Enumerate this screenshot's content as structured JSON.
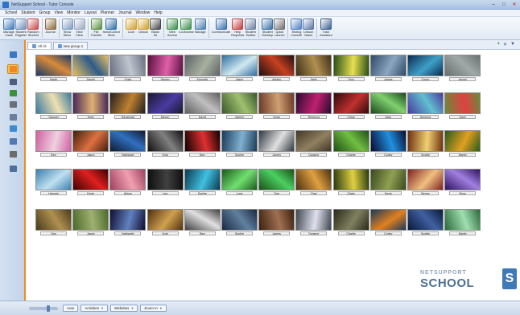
{
  "window": {
    "title": "NetSupport School - Tutor Console"
  },
  "menu": [
    "School",
    "Student",
    "Group",
    "View",
    "Monitor",
    "Layout",
    "Planner",
    "Journal",
    "Window",
    "Help"
  ],
  "toolbar": [
    {
      "id": "manage-class",
      "label": "Manage\nClass",
      "color": "#3f7ab8"
    },
    {
      "id": "student-register",
      "label": "Student\nRegister",
      "color": "#6f8fb8"
    },
    {
      "id": "random-student",
      "label": "Random\nStudent",
      "color": "#c94b4b"
    },
    {
      "sep": true
    },
    {
      "id": "journal",
      "label": "Journal",
      "color": "#8a6a3c"
    },
    {
      "sep": true
    },
    {
      "id": "show-menu",
      "label": "Show\nMenu",
      "color": "#7d9cc2"
    },
    {
      "id": "view-clear",
      "label": "View\nClear",
      "color": "#9aa9bd"
    },
    {
      "sep": true
    },
    {
      "id": "file-transfer",
      "label": "File\nTransfer",
      "color": "#5a8f3c"
    },
    {
      "id": "send-collect-work",
      "label": "Send/Collect\nWork",
      "color": "#2e6fa8"
    },
    {
      "sep": true
    },
    {
      "id": "lock",
      "label": "Lock",
      "color": "#d1a12a"
    },
    {
      "id": "unlock",
      "label": "Unlock",
      "color": "#d1a12a"
    },
    {
      "id": "blank-all",
      "label": "Blank\nAll",
      "color": "#474747"
    },
    {
      "sep": true
    },
    {
      "id": "web-access",
      "label": "Web\nAccess",
      "color": "#3c8f4a"
    },
    {
      "id": "co-browse",
      "label": "Co-Browse",
      "color": "#3c8f4a"
    },
    {
      "id": "manage",
      "label": "Manage",
      "color": "#4a7ab0"
    },
    {
      "sep": true
    },
    {
      "id": "communicate",
      "label": "Communicate",
      "color": "#3b6fb0"
    },
    {
      "id": "help-requests",
      "label": "Help\nRequests",
      "color": "#c03c3c"
    },
    {
      "id": "student-toolbar",
      "label": "Student\nToolbar",
      "color": "#6a7fa0"
    },
    {
      "sep": true
    },
    {
      "id": "student-desktop",
      "label": "Student\nDesktop",
      "color": "#3a6da6"
    },
    {
      "id": "quick-launch",
      "label": "Quick\nLaunch",
      "color": "#6f6f6f"
    },
    {
      "sep": true
    },
    {
      "id": "testing-console",
      "label": "Testing\nConsole",
      "color": "#4f82c0"
    },
    {
      "id": "lesson-name",
      "label": "Lesson\nName",
      "color": "#5a75a8"
    },
    {
      "sep": true
    },
    {
      "id": "tutor-assistant",
      "label": "Tutor\nAssistant",
      "color": "#3b5f90"
    }
  ],
  "tabs": [
    {
      "label": "All cli",
      "active": true
    },
    {
      "label": "new group 1",
      "active": false
    }
  ],
  "sidebar_icons": [
    {
      "name": "home-icon",
      "color": "#3a78c2"
    },
    {
      "name": "thumbnail-view-icon",
      "color": "#f08a1e"
    },
    {
      "name": "headphones-icon",
      "color": "#4d5f7a"
    },
    {
      "name": "web-icon",
      "color": "#3e8f3e"
    },
    {
      "name": "apps-icon",
      "color": "#6a6f7a"
    },
    {
      "name": "printer-icon",
      "color": "#6b7d99"
    },
    {
      "name": "survey-icon",
      "color": "#3d8bd0"
    },
    {
      "name": "question-icon",
      "color": "#4f79b0"
    },
    {
      "name": "devices-icon",
      "color": "#6b6b6b"
    },
    {
      "name": "chart-icon",
      "color": "#4f6f99"
    }
  ],
  "students": [
    [
      "Sarah",
      "Daniel",
      "Craig",
      "Steven",
      "Kenneth",
      "Jason",
      "Ashley",
      "Beth",
      "Tony",
      "James",
      "Conor",
      "Jacqui"
    ],
    [
      "Samuel",
      "Kelly",
      "Savannah",
      "Meyvn",
      "David",
      "Ashley",
      "Dean",
      "Rebecca",
      "Chloe",
      "Jane",
      "Shreena",
      "Dave"
    ],
    [
      "Ben",
      "Jason",
      "Nathaniel",
      "Kyla",
      "Ben",
      "Sophie",
      "James",
      "Dwayne",
      "Charlie",
      "Corley",
      "Scottie",
      "Martin"
    ],
    [
      "Hannah",
      "Kevin",
      "Alison",
      "Lea",
      "Sophie",
      "Luca",
      "Tom",
      "Paul",
      "Claire",
      "Kevin",
      "Benny",
      "Ross"
    ],
    [
      "Dan",
      "Jacob",
      "Nathaniel",
      "Kyla",
      "Bea",
      "Sophie",
      "James",
      "Dwayne",
      "Charlie",
      "Corley",
      "Scottie",
      "Martin"
    ]
  ],
  "thumb_colors": [
    [
      [
        "#1a3a66",
        "#d88a3a"
      ],
      [
        "#e8c060",
        "#2e5a8a"
      ],
      [
        "#6a6f80",
        "#c0c6d0"
      ],
      [
        "#5a1040",
        "#e060a8"
      ],
      [
        "#5c6468",
        "#a8b0a0"
      ],
      [
        "#3070a0",
        "#d0e8f0"
      ],
      [
        "#201010",
        "#c84020"
      ],
      [
        "#403018",
        "#b09050"
      ],
      [
        "#2a5018",
        "#e8e050"
      ],
      [
        "#304a68",
        "#8aa6c0"
      ],
      [
        "#0a2a50",
        "#3fa0c8"
      ],
      [
        "#6a7070",
        "#a0a8a8"
      ]
    ],
    [
      [
        "#3a7aa0",
        "#f0e0b0"
      ],
      [
        "#4a2a5a",
        "#e0b070"
      ],
      [
        "#202020",
        "#c08030"
      ],
      [
        "#1a1a30",
        "#4a3aa0"
      ],
      [
        "#606060",
        "#c0c0c0"
      ],
      [
        "#3a5a2a",
        "#a0c070"
      ],
      [
        "#6a3a2a",
        "#d0a070"
      ],
      [
        "#2a0a30",
        "#c02070"
      ],
      [
        "#300a0a",
        "#c03030"
      ],
      [
        "#1a4a1a",
        "#80d070"
      ],
      [
        "#4a3aa0",
        "#60c0d0"
      ],
      [
        "#6a8a3a",
        "#e04040"
      ]
    ],
    [
      [
        "#d060a0",
        "#f0d0e0"
      ],
      [
        "#402010",
        "#e07040"
      ],
      [
        "#101a30",
        "#3070c0"
      ],
      [
        "#101010",
        "#808080"
      ],
      [
        "#100000",
        "#e03030"
      ],
      [
        "#1a3a5a",
        "#80b0d0"
      ],
      [
        "#303840",
        "#e0e0e0"
      ],
      [
        "#403828",
        "#908060"
      ],
      [
        "#205018",
        "#70c040"
      ],
      [
        "#0a0a30",
        "#2090e0"
      ],
      [
        "#703010",
        "#f0d070"
      ],
      [
        "#2a5a1a",
        "#e0a020"
      ]
    ],
    [
      [
        "#3a80b0",
        "#c0e0f0"
      ],
      [
        "#400000",
        "#e02020"
      ],
      [
        "#a04060",
        "#f0a0b0"
      ],
      [
        "#101010",
        "#404040"
      ],
      [
        "#0a3a50",
        "#40c0e0"
      ],
      [
        "#1a5a1a",
        "#70e070"
      ],
      [
        "#1a5018",
        "#4ad060"
      ],
      [
        "#4a3010",
        "#e0a040"
      ],
      [
        "#2a3a10",
        "#e0d040"
      ],
      [
        "#3a4a20",
        "#90a050"
      ],
      [
        "#802020",
        "#f0c080"
      ],
      [
        "#301060",
        "#a080e0"
      ]
    ],
    [
      [
        "#4a3a1a",
        "#b09050"
      ],
      [
        "#4a6a2a",
        "#a0b070"
      ],
      [
        "#101030",
        "#6080c0"
      ],
      [
        "#503010",
        "#d0a050"
      ],
      [
        "#404040",
        "#e0e0e0"
      ],
      [
        "#1a2a40",
        "#6080a0"
      ],
      [
        "#3a2010",
        "#a07050"
      ],
      [
        "#404850",
        "#e0e0f0"
      ],
      [
        "#2a2a1a",
        "#808060"
      ],
      [
        "#1a3a5a",
        "#e08020"
      ],
      [
        "#0a1a3a",
        "#4060a0"
      ],
      [
        "#2a6a3a",
        "#a0e0b0"
      ]
    ]
  ],
  "brand": {
    "top": "NETSUPPORT",
    "bottom": "SCHOOL",
    "badge": "S"
  },
  "statusbar": {
    "auto": "Auto",
    "activities": "Activities",
    "websites": "Websites",
    "zoom_in": "Zoom In"
  }
}
